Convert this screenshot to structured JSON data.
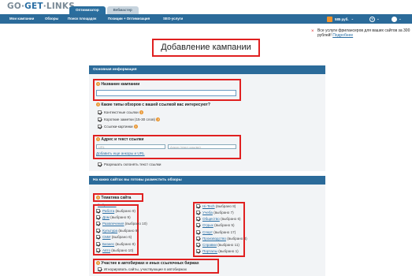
{
  "logo": {
    "part1": "GO",
    "part2": "GET",
    "part3": "LINKS"
  },
  "top_tabs": [
    {
      "label": "Оптимизатор",
      "active": true
    },
    {
      "label": "Вебмастер",
      "active": false
    }
  ],
  "nav": {
    "items": [
      "Мои кампании",
      "Обзоры",
      "Поиск площадок",
      "Позиции + Оптимизация",
      "SEO-услуги"
    ],
    "balance": "585 руб.",
    "balance_icon": "rss-icon",
    "help_icon": "help-icon",
    "user_icon": "user-icon"
  },
  "promo": {
    "text": "Все услуги фрилансеров для ваших сайтов за 300 рублей!",
    "link": "Подробнее"
  },
  "page_title": "Добавление кампании",
  "section1": {
    "header": "Основная информация",
    "campaign_name_label": "Название кампании",
    "campaign_name_value": "",
    "review_types_label": "Какие типы обзоров с вашей ссылкой вас интересуют?",
    "review_types": [
      {
        "label": "Контекстные ссылки",
        "checked": true,
        "help": true
      },
      {
        "label": "Короткие заметки (15-30 слов)",
        "checked": true,
        "help": true
      },
      {
        "label": "Ссылки-картинки",
        "checked": true,
        "help": true
      }
    ],
    "address_label": "Адрес и текст ссылки",
    "url_placeholder": "URL",
    "anchor_placeholder": "Анкор (текст ссылки)",
    "add_anchors_link": "Добавить еще анкоры и URL",
    "allow_change_text": "Разрешать склонять текст ссылки"
  },
  "section2": {
    "header": "На каких сайтах вы готовы разместить обзоры",
    "topic_label": "Тематика сайта",
    "select_all": "Выбрать все",
    "left_topics": [
      {
        "label": "Работа",
        "count": "(выбрано 9)"
      },
      {
        "label": "Дом",
        "count": "(выбрано 9)"
      },
      {
        "label": "Развлечения",
        "count": "(выбрано 10)"
      },
      {
        "label": "Культура",
        "count": "(выбрано 9)"
      },
      {
        "label": "СМИ",
        "count": "(выбрано 6)"
      },
      {
        "label": "Бизнес",
        "count": "(выбрано 8)"
      },
      {
        "label": "Авто",
        "count": "(выбрано 10)"
      }
    ],
    "right_topics": [
      {
        "label": "Hi-Tech",
        "count": "(выбрано 8)"
      },
      {
        "label": "Учеба",
        "count": "(выбрано 7)"
      },
      {
        "label": "Общество",
        "count": "(выбрано 6)"
      },
      {
        "label": "Отдых",
        "count": "(выбрано 5)"
      },
      {
        "label": "Спорт",
        "count": "(выбрано 17)"
      },
      {
        "label": "Производство",
        "count": "(выбрано 4)"
      },
      {
        "label": "Справки",
        "count": "(выбрано 11)"
      },
      {
        "label": "Порталы",
        "count": "(выбрано 1)"
      }
    ],
    "exchange_label": "Участие в автобиржах и иных ссылочных биржах",
    "ignore_exchange": "Игнорировать сайты, участвующие в автобиржах"
  }
}
